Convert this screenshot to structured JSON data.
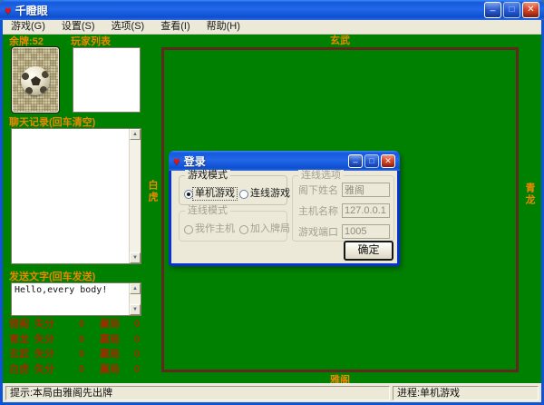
{
  "icons": {
    "heart": "♥",
    "scroll_up": "▲",
    "scroll_down": "▼"
  },
  "window": {
    "title": "千瞪眼",
    "controls": {
      "minimize": "_",
      "maximize": "□",
      "close": "✕"
    }
  },
  "menu": {
    "items": [
      {
        "label": "游戏(G)"
      },
      {
        "label": "设置(S)"
      },
      {
        "label": "选项(S)"
      },
      {
        "label": "查看(I)"
      },
      {
        "label": "帮助(H)"
      }
    ]
  },
  "left_panel": {
    "remaining_cards_label": "余牌:52",
    "player_list_label": "玩家列表",
    "chat_log_label": "聊天记录(回车清空)",
    "chat_log_text": "",
    "send_label": "发送文字(回车发送)",
    "send_text": "Hello,every body!"
  },
  "scoreboard": {
    "rows": [
      {
        "name": "雅阁",
        "loss_label": "失分",
        "loss": "0",
        "win_label": "赢局",
        "wins": "0"
      },
      {
        "name": "青龙",
        "loss_label": "失分",
        "loss": "0",
        "win_label": "赢局",
        "wins": "0"
      },
      {
        "name": "玄武",
        "loss_label": "失分",
        "loss": "0",
        "win_label": "赢局",
        "wins": "0"
      },
      {
        "name": "白虎",
        "loss_label": "失分",
        "loss": "0",
        "win_label": "赢局",
        "wins": "0"
      }
    ]
  },
  "table_labels": {
    "top": "玄武",
    "right": "青龙",
    "left": "白虎",
    "bottom": "雅阁"
  },
  "dialog": {
    "title": "登录",
    "controls": {
      "minimize": "_",
      "maximize": "□",
      "close": "✕"
    },
    "game_mode": {
      "label": "游戏模式",
      "options": [
        {
          "label": "单机游戏",
          "selected": true
        },
        {
          "label": "连线游戏",
          "selected": false
        }
      ]
    },
    "conn_mode": {
      "label": "连线模式",
      "disabled": true,
      "options": [
        {
          "label": "我作主机",
          "selected": false
        },
        {
          "label": "加入牌局",
          "selected": false
        }
      ]
    },
    "conn_options": {
      "label": "连线选项",
      "disabled": true,
      "fields": [
        {
          "label": "阁下姓名",
          "value": "雅阁"
        },
        {
          "label": "主机名称",
          "value": "127.0.0.1"
        },
        {
          "label": "游戏端口",
          "value": "1005"
        }
      ]
    },
    "ok_label": "确定"
  },
  "status_bar": {
    "left": "提示:本局由雅阁先出牌",
    "right": "进程:单机游戏"
  },
  "colors": {
    "table_green": "#008000",
    "label_orange": "#ef8600",
    "score_maroon": "#9a2e00",
    "xp_blue": "#0f54d7",
    "table_border": "#5f2a1d"
  }
}
